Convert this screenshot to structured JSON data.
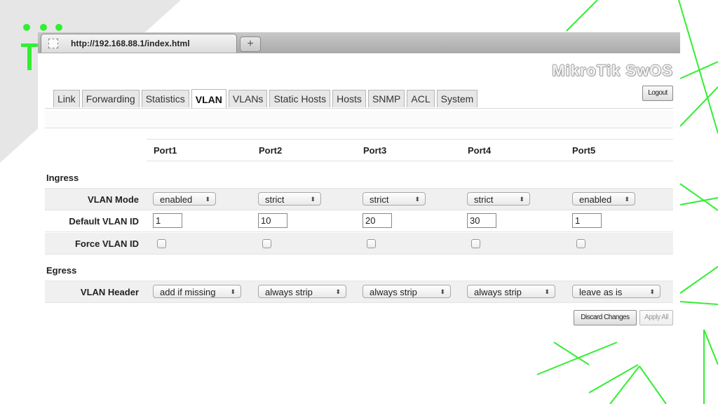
{
  "browser": {
    "url": "http://192.168.88.1/index.html",
    "new_tab": "+"
  },
  "app": {
    "brand": "MikroTik SwOS",
    "logout": "Logout"
  },
  "nav_tabs": [
    {
      "label": "Link",
      "active": false
    },
    {
      "label": "Forwarding",
      "active": false
    },
    {
      "label": "Statistics",
      "active": false
    },
    {
      "label": "VLAN",
      "active": true
    },
    {
      "label": "VLANs",
      "active": false
    },
    {
      "label": "Static Hosts",
      "active": false
    },
    {
      "label": "Hosts",
      "active": false
    },
    {
      "label": "SNMP",
      "active": false
    },
    {
      "label": "ACL",
      "active": false
    },
    {
      "label": "System",
      "active": false
    }
  ],
  "ports": [
    "Port1",
    "Port2",
    "Port3",
    "Port4",
    "Port5"
  ],
  "sections": {
    "ingress": "Ingress",
    "egress": "Egress"
  },
  "rows": {
    "vlan_mode": {
      "label": "VLAN Mode",
      "values": [
        "enabled",
        "strict",
        "strict",
        "strict",
        "enabled"
      ]
    },
    "default_vlan_id": {
      "label": "Default VLAN ID",
      "values": [
        "1",
        "10",
        "20",
        "30",
        "1"
      ]
    },
    "force_vlan_id": {
      "label": "Force VLAN ID",
      "values": [
        false,
        false,
        false,
        false,
        false
      ]
    },
    "vlan_header": {
      "label": "VLAN Header",
      "values": [
        "add if missing",
        "always strip",
        "always strip",
        "always strip",
        "leave as is"
      ]
    }
  },
  "buttons": {
    "discard": "Discard Changes",
    "apply": "Apply All"
  },
  "colors": {
    "accent_green": "#33ee33",
    "background_gray": "#e6e6e6"
  },
  "caret_glyph": "⬍"
}
